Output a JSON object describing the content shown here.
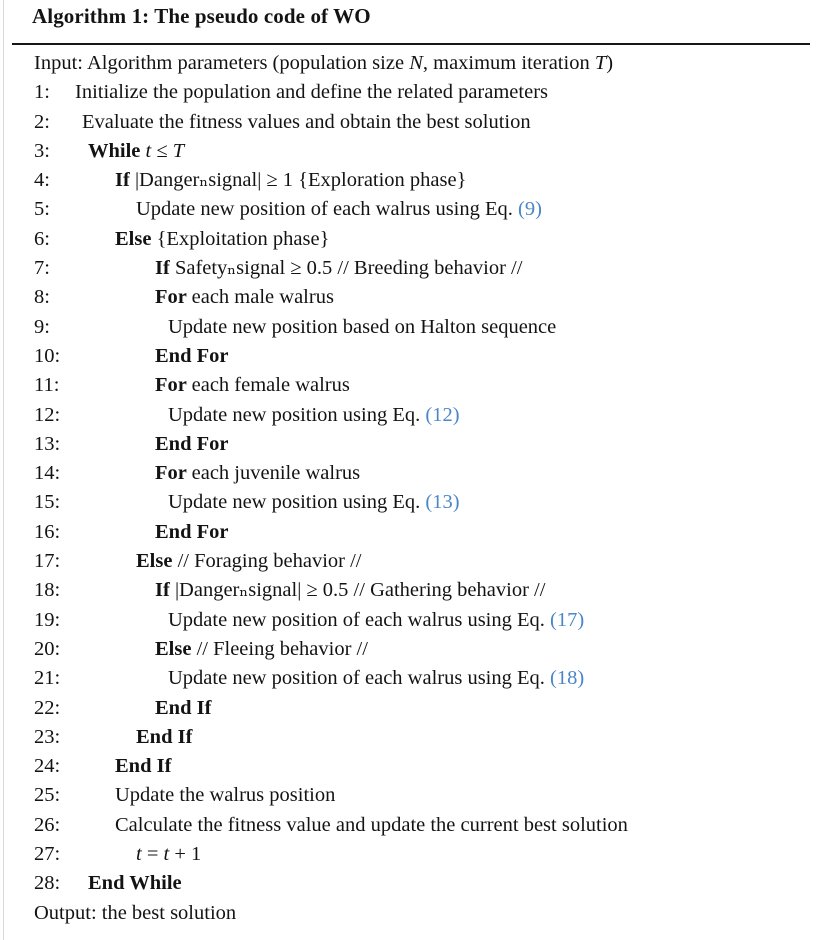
{
  "title": "Algorithm 1: The pseudo code of WO",
  "accent_color": "#4a86c8",
  "text_color": "#131313",
  "input_line": {
    "label": "Input:",
    "segments": [
      {
        "t": "Input: Algorithm parameters (population size ",
        "s": "plain"
      },
      {
        "t": "N",
        "s": "italic"
      },
      {
        "t": ", maximum iteration ",
        "s": "plain"
      },
      {
        "t": "T",
        "s": "italic"
      },
      {
        "t": ")",
        "s": "plain"
      }
    ]
  },
  "output_line": {
    "label": "Output:",
    "segments": [
      {
        "t": "Output: the best solution",
        "s": "plain"
      }
    ]
  },
  "steps": [
    {
      "num": "1:",
      "indent": 1,
      "text": "Initialize the population and define the related parameters",
      "segments": [
        {
          "t": "Initialize the population and define the related parameters",
          "s": "plain"
        }
      ]
    },
    {
      "num": "2:",
      "indent": 2,
      "text": "Evaluate the fitness values and obtain the best solution",
      "segments": [
        {
          "t": "Evaluate the fitness values and obtain the best solution",
          "s": "plain"
        }
      ]
    },
    {
      "num": "3:",
      "indent": 3,
      "text": "While t ≤ T",
      "segments": [
        {
          "t": "While ",
          "s": "bold"
        },
        {
          "t": "t",
          "s": "italic"
        },
        {
          "t": " ≤ ",
          "s": "plain"
        },
        {
          "t": "T",
          "s": "italic"
        }
      ]
    },
    {
      "num": "4:",
      "indent": 4,
      "text": "If |Danger_signal| ≥ 1 {Exploration phase}",
      "segments": [
        {
          "t": "If ",
          "s": "bold"
        },
        {
          "t": "|Dangerₙsignal| ≥ 1 {Exploration phase}",
          "s": "plain"
        }
      ]
    },
    {
      "num": "5:",
      "indent": 5,
      "text": "Update new position of each walrus using Eq. (9)",
      "segments": [
        {
          "t": "Update new position of each walrus using Eq. ",
          "s": "plain"
        },
        {
          "t": "(9)",
          "s": "eq"
        }
      ]
    },
    {
      "num": "6:",
      "indent": 4,
      "text": "Else {Exploitation phase}",
      "segments": [
        {
          "t": "Else ",
          "s": "bold"
        },
        {
          "t": "{Exploitation phase}",
          "s": "plain"
        }
      ]
    },
    {
      "num": "7:",
      "indent": 6,
      "text": "If Safety_signal ≥ 0.5 // Breeding behavior //",
      "segments": [
        {
          "t": "If ",
          "s": "bold"
        },
        {
          "t": "Safetyₙsignal ≥ 0.5 // Breeding behavior //",
          "s": "plain"
        }
      ]
    },
    {
      "num": "8:",
      "indent": 6,
      "text": "For each male walrus",
      "segments": [
        {
          "t": "For ",
          "s": "bold"
        },
        {
          "t": "each male walrus",
          "s": "plain"
        }
      ]
    },
    {
      "num": "9:",
      "indent": 7,
      "text": "Update new position based on Halton sequence",
      "segments": [
        {
          "t": "Update new position based on Halton sequence",
          "s": "plain"
        }
      ]
    },
    {
      "num": "10:",
      "indent": 6,
      "text": "End For",
      "segments": [
        {
          "t": "End For",
          "s": "bold"
        }
      ]
    },
    {
      "num": "11:",
      "indent": 6,
      "text": "For each female walrus",
      "segments": [
        {
          "t": "For ",
          "s": "bold"
        },
        {
          "t": "each female walrus",
          "s": "plain"
        }
      ]
    },
    {
      "num": "12:",
      "indent": 7,
      "text": "Update new position using Eq. (12)",
      "segments": [
        {
          "t": "Update new position using Eq. ",
          "s": "plain"
        },
        {
          "t": "(12)",
          "s": "eq"
        }
      ]
    },
    {
      "num": "13:",
      "indent": 6,
      "text": "End For",
      "segments": [
        {
          "t": "End For",
          "s": "bold"
        }
      ]
    },
    {
      "num": "14:",
      "indent": 6,
      "text": "For each juvenile walrus",
      "segments": [
        {
          "t": "For ",
          "s": "bold"
        },
        {
          "t": "each juvenile walrus",
          "s": "plain"
        }
      ]
    },
    {
      "num": "15:",
      "indent": 7,
      "text": "Update new position using Eq. (13)",
      "segments": [
        {
          "t": "Update new position using Eq. ",
          "s": "plain"
        },
        {
          "t": "(13)",
          "s": "eq"
        }
      ]
    },
    {
      "num": "16:",
      "indent": 6,
      "text": "End For",
      "segments": [
        {
          "t": "End For",
          "s": "bold"
        }
      ]
    },
    {
      "num": "17:",
      "indent": 5,
      "text": "Else // Foraging behavior //",
      "segments": [
        {
          "t": "Else ",
          "s": "bold"
        },
        {
          "t": "// Foraging behavior //",
          "s": "plain"
        }
      ]
    },
    {
      "num": "18:",
      "indent": 6,
      "text": "If |Danger_signal| ≥ 0.5 // Gathering behavior //",
      "segments": [
        {
          "t": "If ",
          "s": "bold"
        },
        {
          "t": "|Dangerₙsignal| ≥ 0.5 // Gathering behavior //",
          "s": "plain"
        }
      ]
    },
    {
      "num": "19:",
      "indent": 7,
      "text": "Update new position of each walrus using Eq. (17)",
      "segments": [
        {
          "t": "Update new position of each walrus using Eq. ",
          "s": "plain"
        },
        {
          "t": "(17)",
          "s": "eq"
        }
      ]
    },
    {
      "num": "20:",
      "indent": 6,
      "text": "Else // Fleeing behavior //",
      "segments": [
        {
          "t": "Else ",
          "s": "bold"
        },
        {
          "t": "// Fleeing behavior //",
          "s": "plain"
        }
      ]
    },
    {
      "num": "21:",
      "indent": 7,
      "text": "Update new position of each walrus using Eq. (18)",
      "segments": [
        {
          "t": "Update new position of each walrus using Eq. ",
          "s": "plain"
        },
        {
          "t": "(18)",
          "s": "eq"
        }
      ]
    },
    {
      "num": "22:",
      "indent": 6,
      "text": "End If",
      "segments": [
        {
          "t": "End If",
          "s": "bold"
        }
      ]
    },
    {
      "num": "23:",
      "indent": 5,
      "text": "End If",
      "segments": [
        {
          "t": "End If",
          "s": "bold"
        }
      ]
    },
    {
      "num": "24:",
      "indent": 4,
      "text": "End If",
      "segments": [
        {
          "t": "End If",
          "s": "bold"
        }
      ]
    },
    {
      "num": "25:",
      "indent": 4,
      "text": "Update the walrus position",
      "segments": [
        {
          "t": "Update the walrus position",
          "s": "plain"
        }
      ]
    },
    {
      "num": "26:",
      "indent": 4,
      "text": "Calculate the fitness value and update the current best solution",
      "segments": [
        {
          "t": "Calculate the fitness value and update the current best solution",
          "s": "plain"
        }
      ]
    },
    {
      "num": "27:",
      "indent": 5,
      "text": "t = t + 1",
      "segments": [
        {
          "t": "t",
          "s": "italic"
        },
        {
          "t": " = ",
          "s": "plain"
        },
        {
          "t": "t",
          "s": "italic"
        },
        {
          "t": " + 1",
          "s": "plain"
        }
      ]
    },
    {
      "num": "28:",
      "indent": 3,
      "text": "End While",
      "segments": [
        {
          "t": "End While",
          "s": "bold"
        }
      ]
    }
  ]
}
